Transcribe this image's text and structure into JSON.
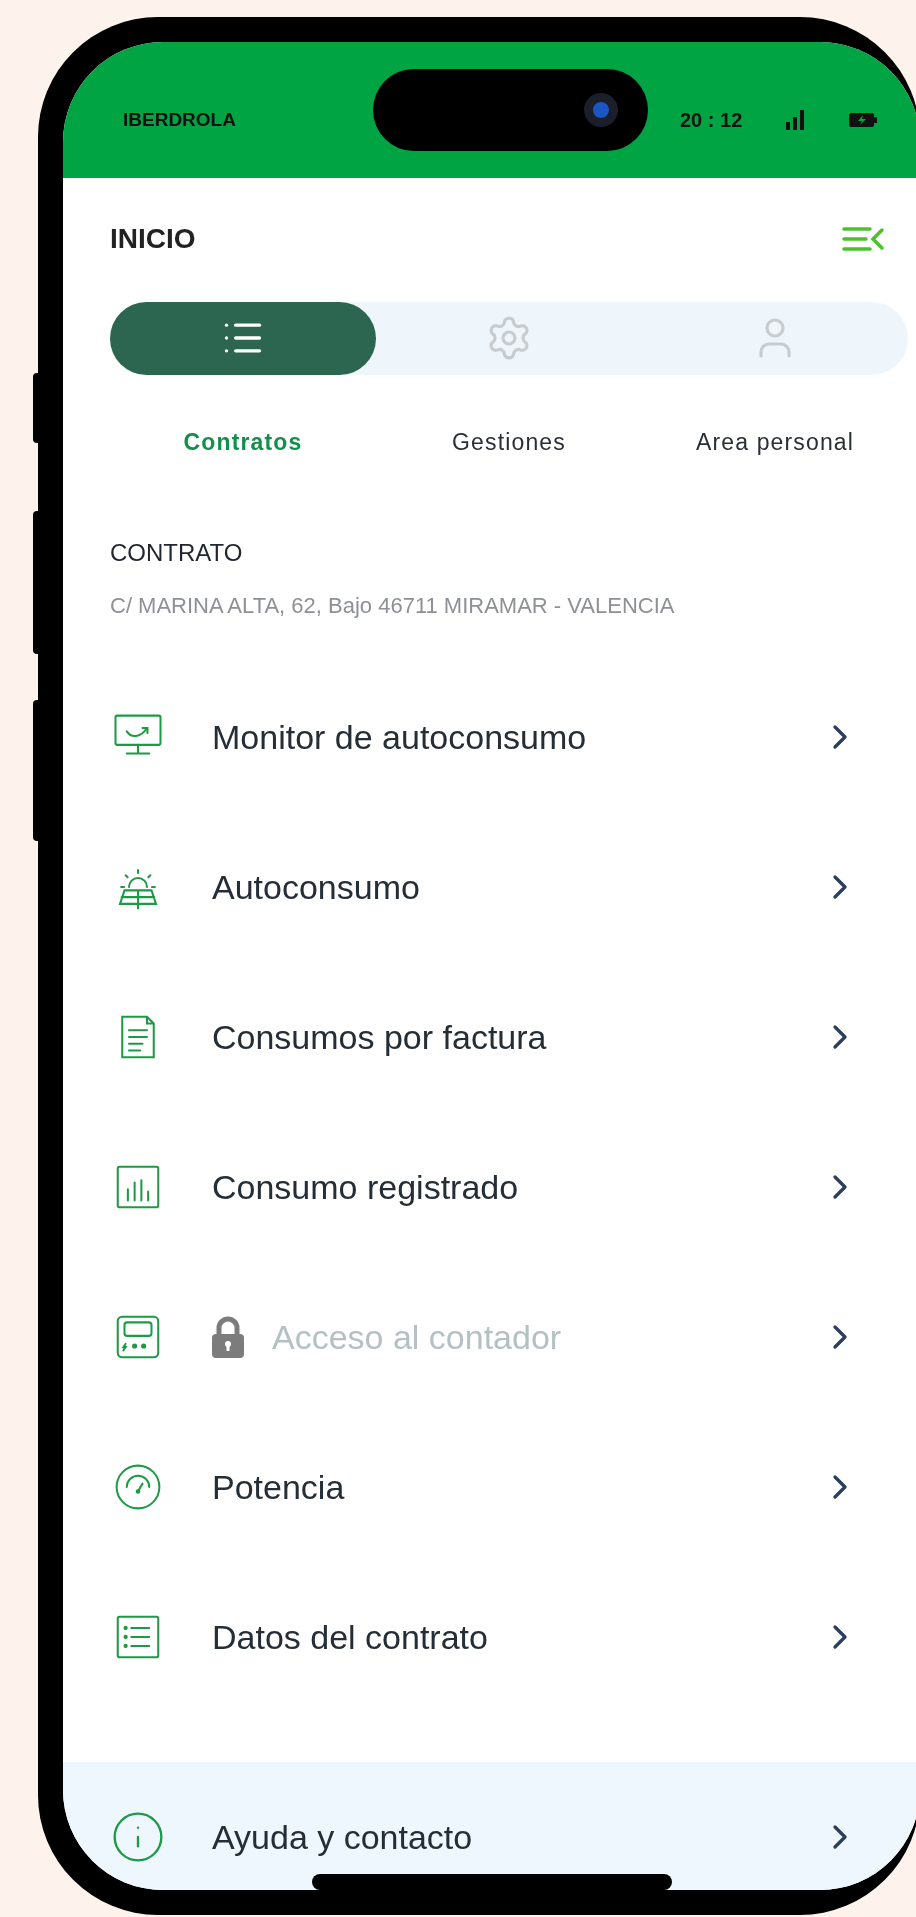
{
  "status_bar": {
    "carrier": "IBERDROLA",
    "time": "20 : 12"
  },
  "header": {
    "title": "INICIO"
  },
  "tabs": [
    {
      "label": "Contratos",
      "kind": "list",
      "selected": true
    },
    {
      "label": "Gestiones",
      "kind": "settings",
      "selected": false
    },
    {
      "label": "Area personal",
      "kind": "person",
      "selected": false
    }
  ],
  "contract": {
    "title": "CONTRATO",
    "address": "C/ MARINA ALTA, 62, Bajo 46711 MIRAMAR - VALENCIA"
  },
  "menu": [
    {
      "label": "Monitor de autoconsumo",
      "kind": "monitor",
      "locked": false
    },
    {
      "label": "Autoconsumo",
      "kind": "solar",
      "locked": false
    },
    {
      "label": "Consumos por factura",
      "kind": "invoice",
      "locked": false
    },
    {
      "label": "Consumo registrado",
      "kind": "chart",
      "locked": false
    },
    {
      "label": "Acceso al contador",
      "kind": "meter",
      "locked": true
    },
    {
      "label": "Potencia",
      "kind": "gauge",
      "locked": false
    },
    {
      "label": "Datos del contrato",
      "kind": "details",
      "locked": false
    }
  ],
  "help_item": {
    "label": "Ayuda y contacto",
    "kind": "info",
    "locked": false
  }
}
